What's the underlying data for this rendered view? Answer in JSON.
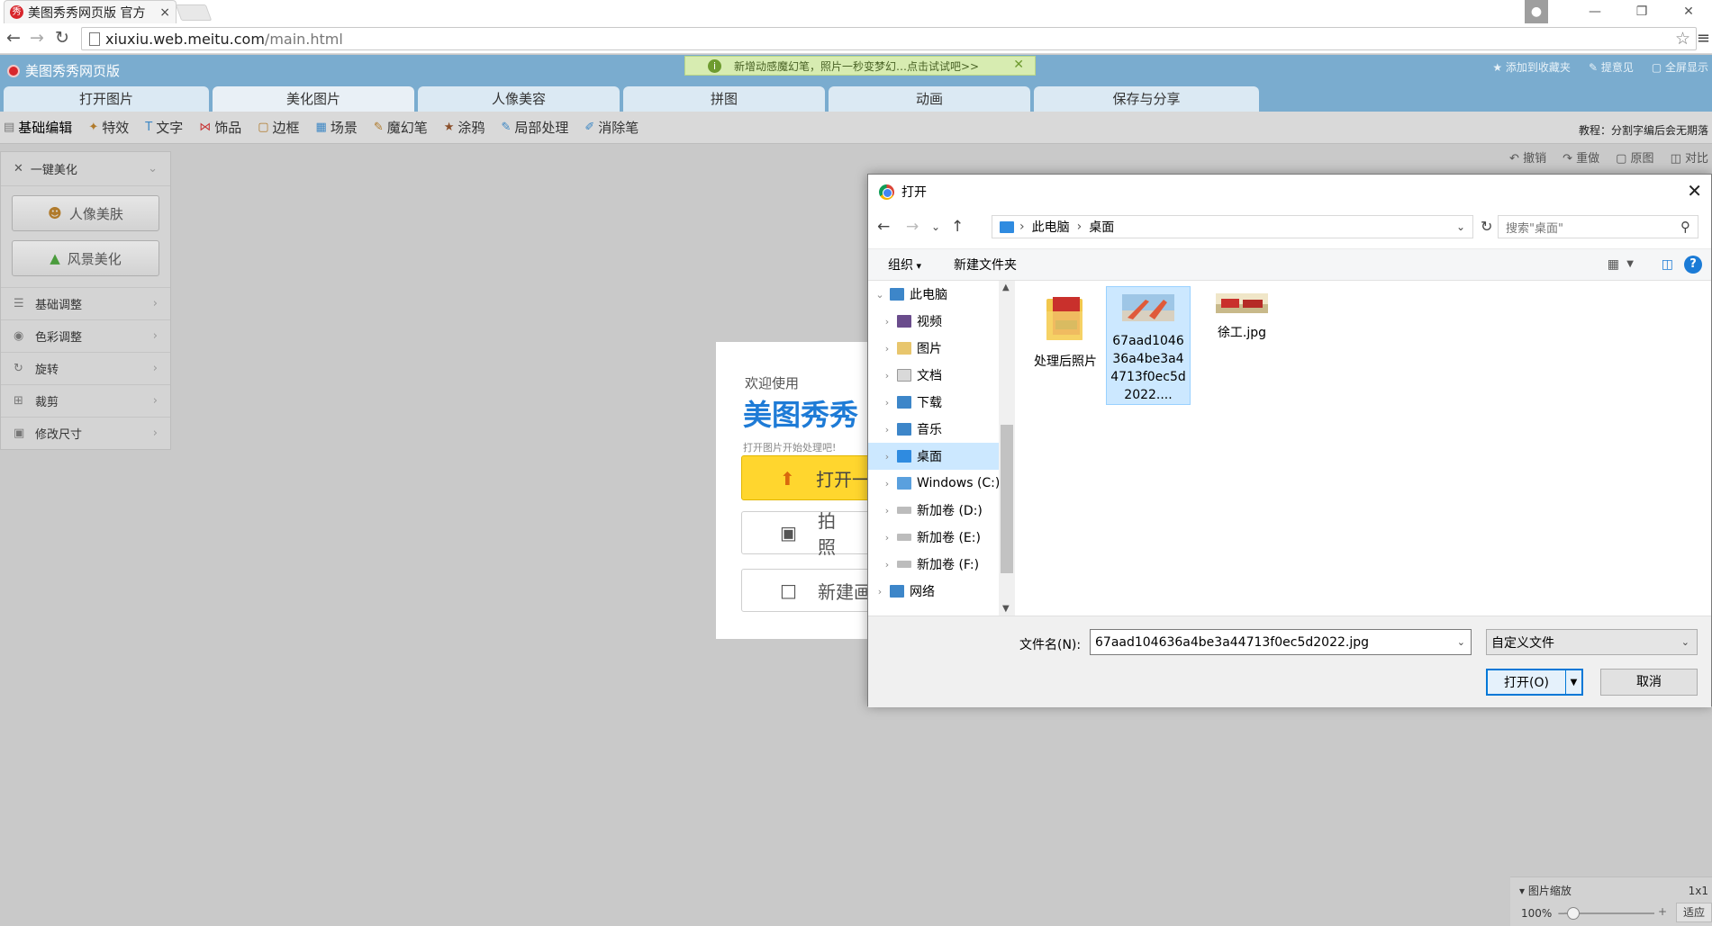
{
  "browser": {
    "tab_title": "美图秀秀网页版 官方",
    "favicon_text": "秀",
    "close": "×",
    "url_host": "xiuxiu.web.meitu.com",
    "url_path": "/main.html"
  },
  "app": {
    "title": "美图秀秀网页版",
    "notice": "新增动感魔幻笔，照片一秒变梦幻…点击试试吧>>",
    "links": [
      "添加到收藏夹",
      "提意见",
      "全屏显示"
    ],
    "tabs": [
      "打开图片",
      "美化图片",
      "人像美容",
      "拼图",
      "动画",
      "保存与分享"
    ],
    "tools": [
      "基础编辑",
      "特效",
      "文字",
      "饰品",
      "边框",
      "场景",
      "魔幻笔",
      "涂鸦",
      "局部处理",
      "消除笔"
    ],
    "tutorial": "教程：分割字编后会无期落",
    "undo_bar": [
      "撤销",
      "重做",
      "原图",
      "对比"
    ],
    "left_panel": {
      "head": "一键美化",
      "buttons": [
        "人像美肤",
        "风景美化"
      ],
      "items": [
        "基础调整",
        "色彩调整",
        "旋转",
        "裁剪",
        "修改尺寸"
      ]
    },
    "welcome": {
      "small": "欢迎使用",
      "big": "美图秀秀",
      "hint": "打开图片开始处理吧!",
      "open": "打开一",
      "photo": "拍 照",
      "new": "新建画"
    },
    "zoom": {
      "title": "图片缩放",
      "ratio": "1x1",
      "percent": "100%",
      "fit": "适应"
    }
  },
  "dialog": {
    "title": "打开",
    "breadcrumb": [
      "此电脑",
      "桌面"
    ],
    "search_placeholder": "搜索\"桌面\"",
    "organize": "组织",
    "new_folder": "新建文件夹",
    "tree": [
      {
        "label": "此电脑",
        "level": 0,
        "expanded": true
      },
      {
        "label": "视频",
        "level": 1
      },
      {
        "label": "图片",
        "level": 1
      },
      {
        "label": "文档",
        "level": 1
      },
      {
        "label": "下载",
        "level": 1
      },
      {
        "label": "音乐",
        "level": 1
      },
      {
        "label": "桌面",
        "level": 1,
        "selected": true
      },
      {
        "label": "Windows (C:)",
        "level": 1
      },
      {
        "label": "新加卷 (D:)",
        "level": 1
      },
      {
        "label": "新加卷 (E:)",
        "level": 1
      },
      {
        "label": "新加卷 (F:)",
        "level": 1
      },
      {
        "label": "网络",
        "level": 0
      }
    ],
    "files": [
      {
        "name": "处理后照片",
        "kind": "folder"
      },
      {
        "name": "67aad104636a4be3a44713f0ec5d2022....",
        "kind": "image",
        "selected": true
      },
      {
        "name": "徐工.jpg",
        "kind": "image"
      }
    ],
    "filename_label": "文件名(N):",
    "filename_value": "67aad104636a4be3a44713f0ec5d2022.jpg",
    "filetype": "自定义文件",
    "open_button": "打开(O)",
    "cancel_button": "取消"
  },
  "colors": {
    "app_blue": "#7aaccf",
    "selection": "#cce8ff",
    "primary_button_border": "#0078d7",
    "welcome_open": "#ffd62e"
  }
}
